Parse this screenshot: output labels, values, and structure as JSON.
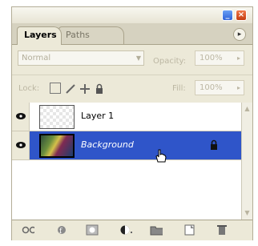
{
  "window": {
    "minimize_label": "_",
    "close_label": "×"
  },
  "tabs": [
    {
      "label": "Layers",
      "active": true
    },
    {
      "label": "Paths",
      "active": false
    }
  ],
  "panel_menu": {
    "icon": "panel-menu-arrow-icon",
    "label": "▸"
  },
  "options": {
    "blend_mode": "Normal",
    "opacity_label": "Opacity:",
    "opacity_value": "100%",
    "lock_label": "Lock:",
    "fill_label": "Fill:",
    "fill_value": "100%"
  },
  "layers": [
    {
      "name": "Layer 1",
      "visible": true,
      "selected": false,
      "locked": false
    },
    {
      "name": "Background",
      "visible": true,
      "selected": true,
      "locked": true
    }
  ],
  "bottom_toolbar": [
    "link-layers-icon",
    "layer-style-icon",
    "layer-mask-icon",
    "adjustment-layer-icon",
    "new-group-icon",
    "new-layer-icon",
    "delete-layer-icon"
  ],
  "colors": {
    "selection": "#2f55c9",
    "panel_bg": "#ece9d8",
    "close_button": "#c43c10",
    "minimize_button": "#2d62d8"
  }
}
